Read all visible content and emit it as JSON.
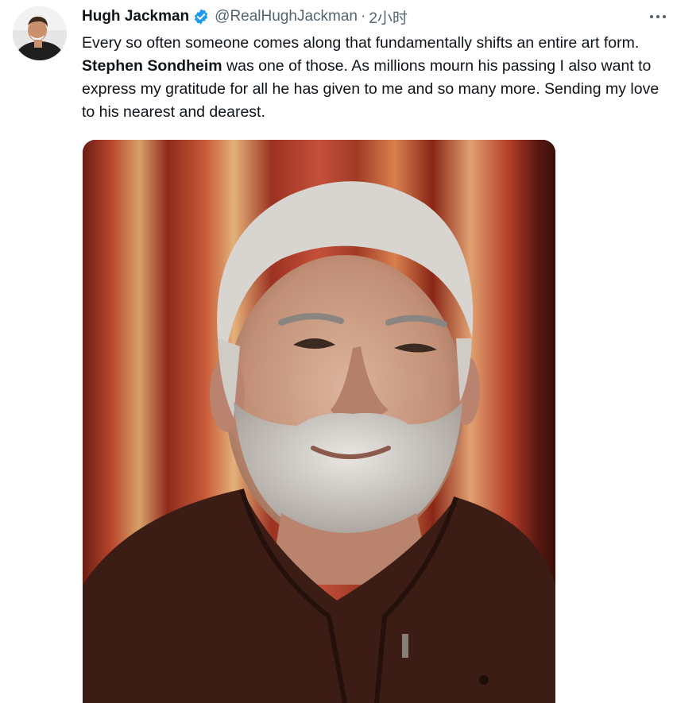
{
  "tweet": {
    "author_name": "Hugh Jackman",
    "handle": "@RealHughJackman",
    "separator": "·",
    "time": "2小时",
    "more_icon": "more-horizontal-icon",
    "verified_icon": "verified-badge-icon",
    "text": {
      "part1": "Every so often someone comes along that fundamentally shifts an entire art form. ",
      "bold_name": "Stephen Sondheim",
      "part2": " was one of those. As millions mourn his passing I also want to express my gratitude for all he has given to me and so many more. Sending my love to his nearest and dearest."
    }
  },
  "colors": {
    "verified_blue": "#1d9bf0",
    "handle_gray": "#536471",
    "text": "#0f1419"
  }
}
